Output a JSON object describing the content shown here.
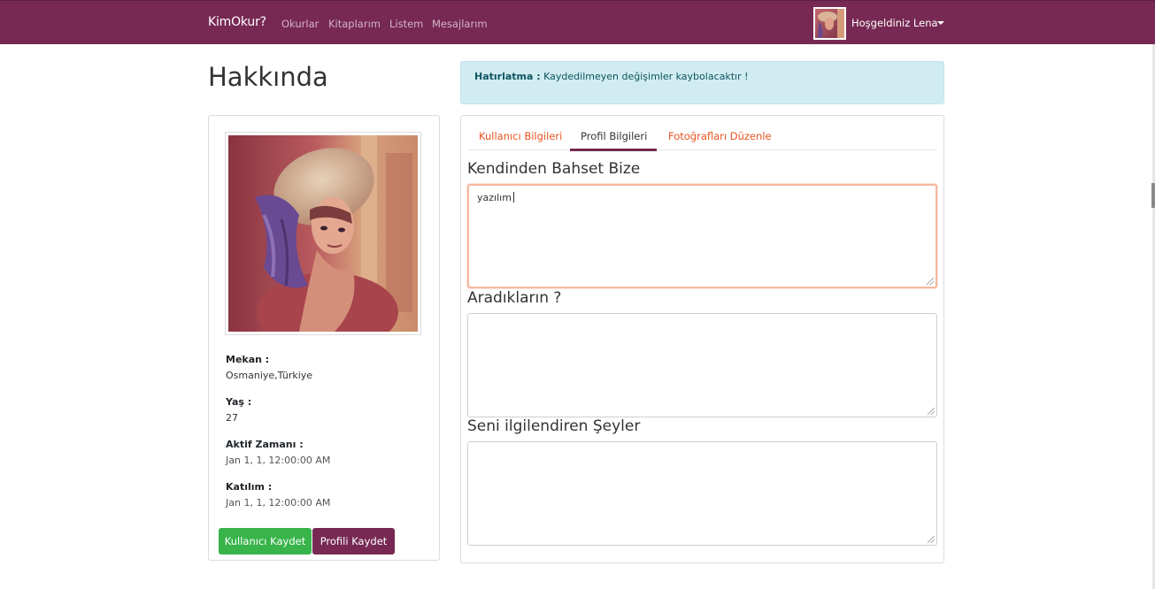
{
  "navbar": {
    "brand": "KimOkur?",
    "links": [
      "Okurlar",
      "Kitaplarım",
      "Listem",
      "Mesajlarım"
    ],
    "user_greeting": "Hoşgeldiniz Lena",
    "user_avatar": "lena-photo"
  },
  "page": {
    "title": "Hakkında"
  },
  "alert": {
    "bold": "Hatırlatma :",
    "text": " Kaydedilmeyen değişimler kaybolacaktır !"
  },
  "profile": {
    "photo": "lena-photo",
    "fields": [
      {
        "label": "Mekan :",
        "value": "Osmaniye,Türkiye"
      },
      {
        "label": "Yaş :",
        "value": "27"
      },
      {
        "label": "Aktif Zamanı :",
        "value": "Jan 1, 1, 12:00:00 AM"
      },
      {
        "label": "Katılım :",
        "value": "Jan 1, 1, 12:00:00 AM"
      }
    ],
    "buttons": {
      "save_user": "Kullanıcı Kaydet",
      "save_profile": "Profili Kaydet"
    }
  },
  "tabs": [
    {
      "label": "Kullanıcı Bilgileri",
      "active": false
    },
    {
      "label": "Profil Bilgileri",
      "active": true
    },
    {
      "label": "Fotoğrafları Düzenle",
      "active": false
    }
  ],
  "sections": [
    {
      "heading": "Kendinden Bahset Bize",
      "value": "yazılım",
      "focused": true
    },
    {
      "heading": "Aradıkların ?",
      "value": ""
    },
    {
      "heading": "Seni ilgilendiren Şeyler",
      "value": ""
    }
  ],
  "colors": {
    "navbar": "#772953",
    "accent": "#e95420",
    "success": "#38b44a",
    "alert_bg": "#d1ecf1"
  }
}
